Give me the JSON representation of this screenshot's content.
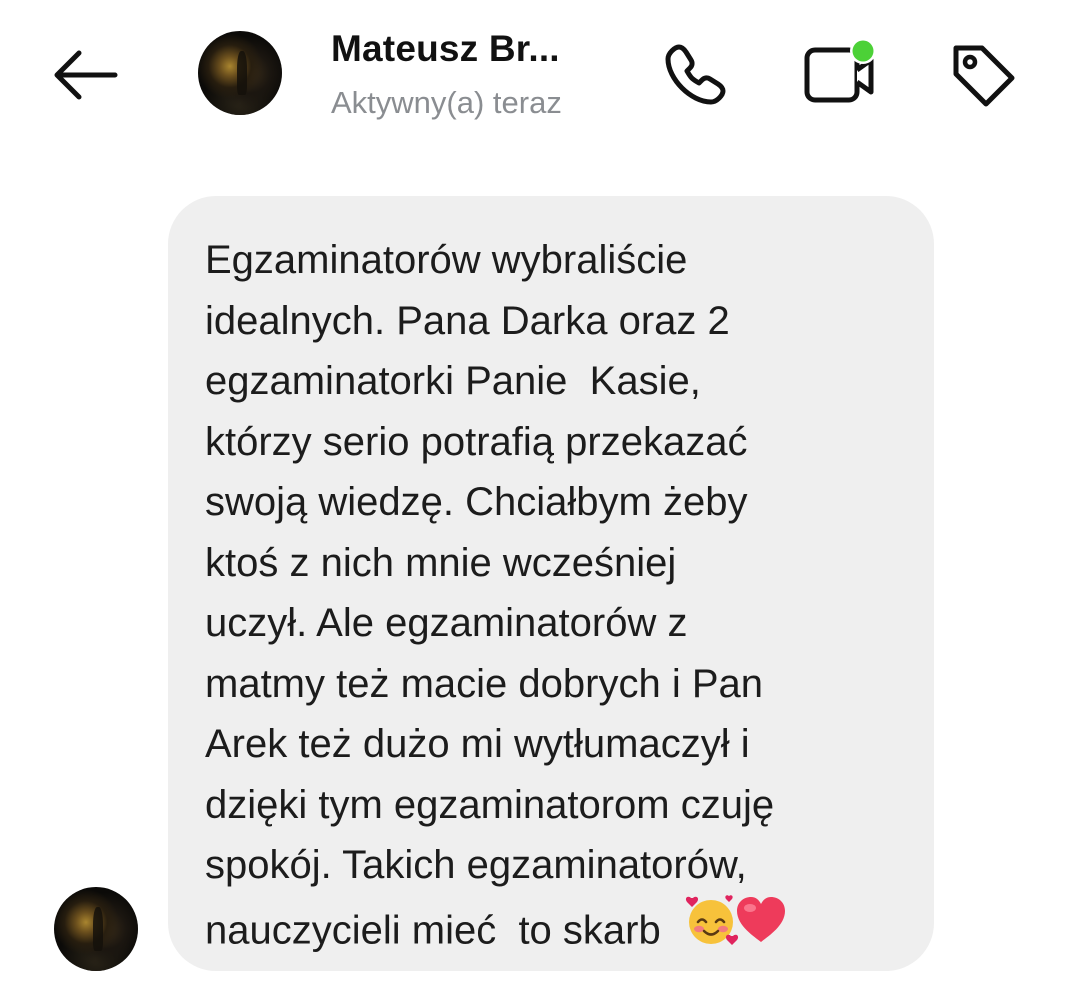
{
  "header": {
    "back_icon": "arrow-left-icon",
    "contact_name": "Mateusz Br...",
    "status": "Aktywny(a) teraz",
    "call_icon": "phone-icon",
    "video_icon": "video-camera-icon",
    "tag_icon": "tag-icon",
    "online_indicator_color": "#4cd137"
  },
  "message": {
    "lines": [
      "Egzaminatorów wybraliście",
      "idealnych. Pana Darka oraz 2",
      "egzaminatorki Panie  Kasie,",
      "którzy serio potrafią przekazać",
      "swoją wiedzę. Chciałbym żeby",
      "ktoś z nich mnie wcześniej",
      "uczył. Ale egzaminatorów z",
      "matmy też macie dobrych i Pan",
      "Arek też dużo mi wytłumaczył i",
      "dzięki tym egzaminatorom czuję",
      "spokój. Takich egzaminatorów,",
      "nauczycieli mieć  to skarb  "
    ],
    "emojis": [
      "smiling-face-with-hearts-icon",
      "red-heart-icon"
    ],
    "bubble_color": "#efefef"
  }
}
